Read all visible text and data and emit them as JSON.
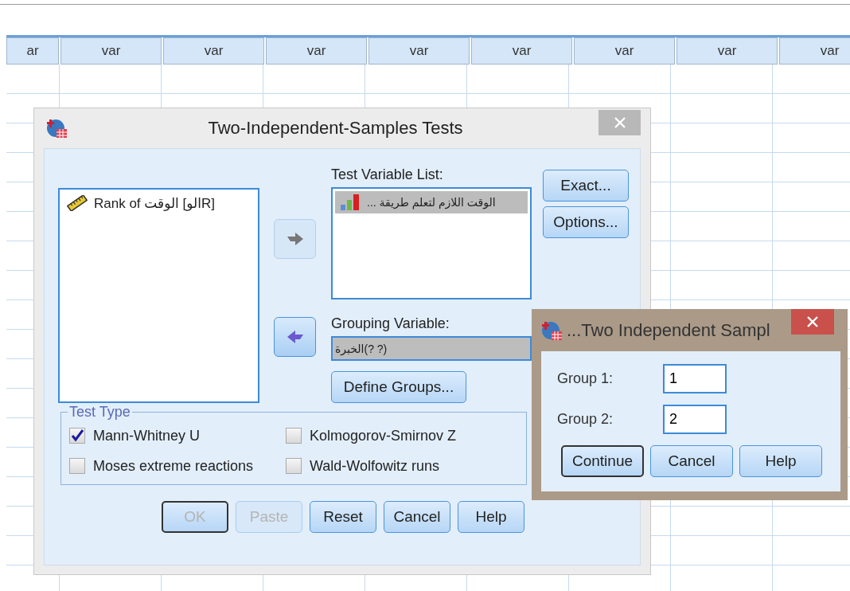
{
  "spreadsheet": {
    "columns": [
      "ar",
      "var",
      "var",
      "var",
      "var",
      "var",
      "var",
      "var",
      "var"
    ]
  },
  "dialog": {
    "title": "Two-Independent-Samples Tests",
    "source_list": [
      {
        "kind": "scale",
        "label": "Rank of الوقت [الوR]",
        "selected": false
      }
    ],
    "move_buttons": [
      {
        "kind": "right",
        "disabled": true
      },
      {
        "kind": "left",
        "disabled": false
      }
    ],
    "test_variable_list": {
      "label": "Test Variable List:",
      "items": [
        {
          "kind": "ordinal",
          "label": "الوقت اللازم لتعلم طريقة ...",
          "selected": true
        }
      ]
    },
    "side_buttons": [
      {
        "label": "Exact...",
        "disabled": false,
        "default": false
      },
      {
        "label": "Options...",
        "disabled": false,
        "default": false
      }
    ],
    "grouping_variable": {
      "label": "Grouping Variable:",
      "value": "الخبرة(? ?)"
    },
    "define_groups_button": "Define Groups...",
    "test_type": {
      "legend": "Test Type",
      "options": [
        {
          "label": "Mann-Whitney U",
          "checked": true
        },
        {
          "label": "Kolmogorov-Smirnov Z",
          "checked": false
        },
        {
          "label": "Moses extreme reactions",
          "checked": false
        },
        {
          "label": "Wald-Wolfowitz runs",
          "checked": false
        }
      ]
    },
    "buttons": [
      {
        "label": "OK",
        "disabled": true,
        "default": true
      },
      {
        "label": "Paste",
        "disabled": true,
        "default": false
      },
      {
        "label": "Reset",
        "disabled": false,
        "default": false
      },
      {
        "label": "Cancel",
        "disabled": false,
        "default": false
      },
      {
        "label": "Help",
        "disabled": false,
        "default": false
      }
    ]
  },
  "subdialog": {
    "title": "...Two Independent Sampl",
    "fields": [
      {
        "label": "Group 1:",
        "value": "1"
      },
      {
        "label": "Group 2:",
        "value": "2"
      }
    ],
    "buttons": [
      {
        "label": "Continue",
        "disabled": false,
        "default": true
      },
      {
        "label": "Cancel",
        "disabled": false,
        "default": false
      },
      {
        "label": "Help",
        "disabled": false,
        "default": false
      }
    ]
  }
}
